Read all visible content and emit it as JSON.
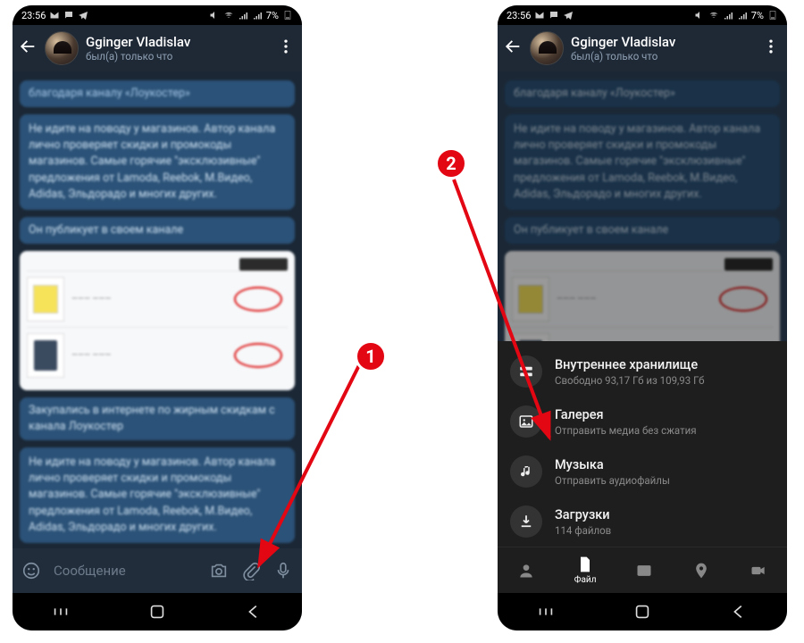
{
  "status": {
    "time": "23:56",
    "battery": "7%"
  },
  "header": {
    "name": "Gginger Vladislav",
    "seen": "был(а) только что"
  },
  "chat": {
    "b1_l1": "благодаря каналу «Лоукостер»",
    "b2": "Не идите на поводу у магазинов. Автор канала лично проверяет скидки и промокоды магазинов. Самые горячие \"эксклюзивные\" предложения от Lamoda, Reebok, М.Видео, Adidas, Эльдорадо и многих других.",
    "b3": "Он публикует в своем канале",
    "b4": "Закупались в интернете по жирным скидкам с канала Лоукостер",
    "b5": "Не идите на поводу у магазинов. Автор канала лично проверяет скидки и промокоды магазинов. Самые горячие \"эксклюзивные\" предложения от Lamoda, Reebok, М.Видео, Adidas, Эльдорадо и многих других."
  },
  "input": {
    "placeholder": "Сообщение"
  },
  "attach": {
    "storage_title": "Внутреннее хранилище",
    "storage_sub": "Свободно 93,17 Гб из 109,93 Гб",
    "gallery_title": "Галерея",
    "gallery_sub": "Отправить медиа без сжатия",
    "music_title": "Музыка",
    "music_sub": "Отправить аудиофайлы",
    "downloads_title": "Загрузки",
    "downloads_sub": "114 файлов",
    "tab_file": "Файл"
  },
  "callouts": {
    "one": "1",
    "two": "2"
  }
}
